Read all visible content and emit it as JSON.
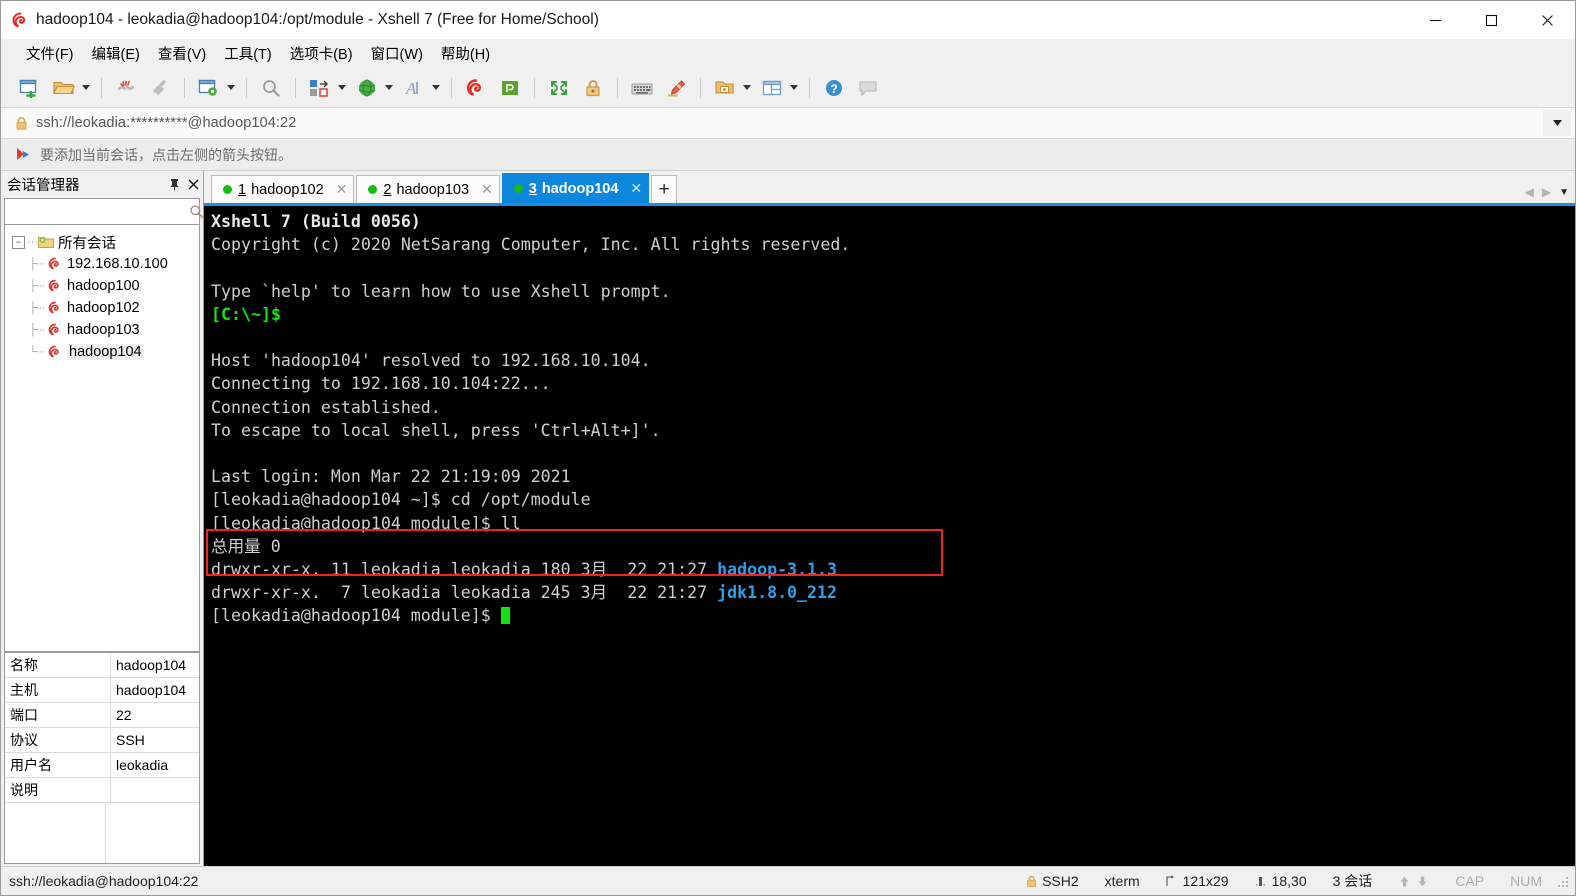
{
  "window": {
    "title": "hadoop104 - leokadia@hadoop104:/opt/module - Xshell 7 (Free for Home/School)",
    "minimize_label": "–",
    "maximize_label": "☐",
    "close_label": "✕"
  },
  "menubar": {
    "items": [
      {
        "label": "文件(F)",
        "name": "menu-file"
      },
      {
        "label": "编辑(E)",
        "name": "menu-edit"
      },
      {
        "label": "查看(V)",
        "name": "menu-view"
      },
      {
        "label": "工具(T)",
        "name": "menu-tools"
      },
      {
        "label": "选项卡(B)",
        "name": "menu-tabs"
      },
      {
        "label": "窗口(W)",
        "name": "menu-window"
      },
      {
        "label": "帮助(H)",
        "name": "menu-help"
      }
    ]
  },
  "toolbar": {
    "icons": [
      "new-session-icon",
      "open-folder-icon",
      "disconnect-icon",
      "connect-link-icon",
      "session-properties-icon",
      "find-icon",
      "layout-arrange-icon",
      "globe-icon",
      "font-icon",
      "xshell-logo-icon",
      "xftp-icon",
      "fullscreen-icon",
      "lock-icon",
      "keyboard-icon",
      "highlight-pen-icon",
      "new-folder-icon",
      "split-view-icon",
      "help-icon",
      "comment-icon"
    ]
  },
  "address_bar": {
    "value": "ssh://leokadia:**********@hadoop104:22",
    "lock_icon": "lock-icon",
    "dropdown_icon": "chevron-down-icon"
  },
  "notification_bar": {
    "icon": "red-arrow-icon",
    "text": "要添加当前会话，点击左侧的箭头按钮。"
  },
  "sidebar": {
    "title": "会话管理器",
    "pin_label": "ᴘ",
    "close_label": "✕",
    "search": {
      "value": "",
      "placeholder": "",
      "icon": "search-icon"
    },
    "tree": {
      "root_label": "所有会话",
      "expander": "−",
      "items": [
        {
          "label": "192.168.10.100",
          "selected": false
        },
        {
          "label": "hadoop100",
          "selected": false
        },
        {
          "label": "hadoop102",
          "selected": false
        },
        {
          "label": "hadoop103",
          "selected": false
        },
        {
          "label": "hadoop104",
          "selected": true
        }
      ]
    },
    "properties": [
      {
        "key": "名称",
        "value": "hadoop104"
      },
      {
        "key": "主机",
        "value": "hadoop104"
      },
      {
        "key": "端口",
        "value": "22"
      },
      {
        "key": "协议",
        "value": "SSH"
      },
      {
        "key": "用户名",
        "value": "leokadia"
      },
      {
        "key": "说明",
        "value": ""
      }
    ]
  },
  "tabs": {
    "items": [
      {
        "num": "1",
        "name": "hadoop102",
        "active": false,
        "close": "✕",
        "status": "connected"
      },
      {
        "num": "2",
        "name": "hadoop103",
        "active": false,
        "close": "✕",
        "status": "connected"
      },
      {
        "num": "3",
        "name": "hadoop104",
        "active": true,
        "close": "✕",
        "status": "connected"
      }
    ],
    "add_label": "+",
    "scroll_left": "◀",
    "scroll_right": "▶",
    "dropdown": "▼"
  },
  "terminal": {
    "lines": [
      {
        "text": "Xshell 7 (Build 0056)",
        "cls": "t-white"
      },
      {
        "text": "Copyright (c) 2020 NetSarang Computer, Inc. All rights reserved.",
        "cls": "t-gray"
      },
      {
        "text": "",
        "cls": "t-gray"
      },
      {
        "text": "Type `help' to learn how to use Xshell prompt.",
        "cls": "t-gray"
      },
      {
        "text": "[C:\\~]$",
        "cls": "t-green"
      },
      {
        "text": "",
        "cls": "t-gray"
      },
      {
        "text": "Host 'hadoop104' resolved to 192.168.10.104.",
        "cls": "t-gray"
      },
      {
        "text": "Connecting to 192.168.10.104:22...",
        "cls": "t-gray"
      },
      {
        "text": "Connection established.",
        "cls": "t-gray"
      },
      {
        "text": "To escape to local shell, press 'Ctrl+Alt+]'.",
        "cls": "t-gray"
      },
      {
        "text": "",
        "cls": "t-gray"
      },
      {
        "text": "Last login: Mon Mar 22 21:19:09 2021",
        "cls": "t-gray"
      },
      {
        "text": "[leokadia@hadoop104 ~]$ cd /opt/module",
        "cls": "t-gray"
      },
      {
        "text": "[leokadia@hadoop104 module]$ ll",
        "cls": "t-gray"
      },
      {
        "text": "总用量 0",
        "cls": "t-gray"
      }
    ],
    "listing": [
      {
        "meta": "drwxr-xr-x. 11 leokadia leokadia 180 3月  22 21:27 ",
        "name": "hadoop-3.1.3"
      },
      {
        "meta": "drwxr-xr-x.  7 leokadia leokadia 245 3月  22 21:27 ",
        "name": "jdk1.8.0_212"
      }
    ],
    "prompt": "[leokadia@hadoop104 module]$ ",
    "colors": {
      "background": "#000000",
      "foreground": "#cccccc",
      "prompt_green": "#13e313",
      "directory_blue": "#2f9fe8",
      "highlight_red": "#f0241e"
    }
  },
  "statusbar": {
    "left": "ssh://leokadia@hadoop104:22",
    "cells": [
      {
        "icon": "lock-icon",
        "label": "SSH2",
        "name": "status-protocol"
      },
      {
        "icon": "",
        "label": "xterm",
        "name": "status-terminal-type"
      },
      {
        "icon": "resize-icon",
        "label": "121x29",
        "name": "status-size"
      },
      {
        "icon": "cursor-icon",
        "label": "18,30",
        "name": "status-cursor-position"
      },
      {
        "icon": "",
        "label": "3 会话",
        "name": "status-session-count"
      }
    ],
    "arrows": {
      "up": "⬆",
      "down": "⬇"
    },
    "cap": "CAP",
    "num": "NUM"
  }
}
